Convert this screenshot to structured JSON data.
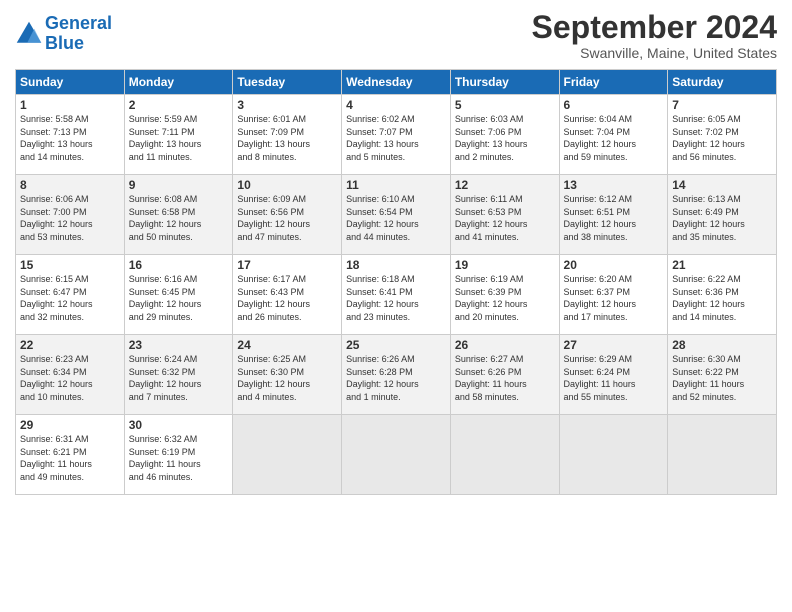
{
  "logo": {
    "line1": "General",
    "line2": "Blue"
  },
  "title": "September 2024",
  "subtitle": "Swanville, Maine, United States",
  "days_of_week": [
    "Sunday",
    "Monday",
    "Tuesday",
    "Wednesday",
    "Thursday",
    "Friday",
    "Saturday"
  ],
  "weeks": [
    [
      {
        "day": "1",
        "info": "Sunrise: 5:58 AM\nSunset: 7:13 PM\nDaylight: 13 hours\nand 14 minutes."
      },
      {
        "day": "2",
        "info": "Sunrise: 5:59 AM\nSunset: 7:11 PM\nDaylight: 13 hours\nand 11 minutes."
      },
      {
        "day": "3",
        "info": "Sunrise: 6:01 AM\nSunset: 7:09 PM\nDaylight: 13 hours\nand 8 minutes."
      },
      {
        "day": "4",
        "info": "Sunrise: 6:02 AM\nSunset: 7:07 PM\nDaylight: 13 hours\nand 5 minutes."
      },
      {
        "day": "5",
        "info": "Sunrise: 6:03 AM\nSunset: 7:06 PM\nDaylight: 13 hours\nand 2 minutes."
      },
      {
        "day": "6",
        "info": "Sunrise: 6:04 AM\nSunset: 7:04 PM\nDaylight: 12 hours\nand 59 minutes."
      },
      {
        "day": "7",
        "info": "Sunrise: 6:05 AM\nSunset: 7:02 PM\nDaylight: 12 hours\nand 56 minutes."
      }
    ],
    [
      {
        "day": "8",
        "info": "Sunrise: 6:06 AM\nSunset: 7:00 PM\nDaylight: 12 hours\nand 53 minutes."
      },
      {
        "day": "9",
        "info": "Sunrise: 6:08 AM\nSunset: 6:58 PM\nDaylight: 12 hours\nand 50 minutes."
      },
      {
        "day": "10",
        "info": "Sunrise: 6:09 AM\nSunset: 6:56 PM\nDaylight: 12 hours\nand 47 minutes."
      },
      {
        "day": "11",
        "info": "Sunrise: 6:10 AM\nSunset: 6:54 PM\nDaylight: 12 hours\nand 44 minutes."
      },
      {
        "day": "12",
        "info": "Sunrise: 6:11 AM\nSunset: 6:53 PM\nDaylight: 12 hours\nand 41 minutes."
      },
      {
        "day": "13",
        "info": "Sunrise: 6:12 AM\nSunset: 6:51 PM\nDaylight: 12 hours\nand 38 minutes."
      },
      {
        "day": "14",
        "info": "Sunrise: 6:13 AM\nSunset: 6:49 PM\nDaylight: 12 hours\nand 35 minutes."
      }
    ],
    [
      {
        "day": "15",
        "info": "Sunrise: 6:15 AM\nSunset: 6:47 PM\nDaylight: 12 hours\nand 32 minutes."
      },
      {
        "day": "16",
        "info": "Sunrise: 6:16 AM\nSunset: 6:45 PM\nDaylight: 12 hours\nand 29 minutes."
      },
      {
        "day": "17",
        "info": "Sunrise: 6:17 AM\nSunset: 6:43 PM\nDaylight: 12 hours\nand 26 minutes."
      },
      {
        "day": "18",
        "info": "Sunrise: 6:18 AM\nSunset: 6:41 PM\nDaylight: 12 hours\nand 23 minutes."
      },
      {
        "day": "19",
        "info": "Sunrise: 6:19 AM\nSunset: 6:39 PM\nDaylight: 12 hours\nand 20 minutes."
      },
      {
        "day": "20",
        "info": "Sunrise: 6:20 AM\nSunset: 6:37 PM\nDaylight: 12 hours\nand 17 minutes."
      },
      {
        "day": "21",
        "info": "Sunrise: 6:22 AM\nSunset: 6:36 PM\nDaylight: 12 hours\nand 14 minutes."
      }
    ],
    [
      {
        "day": "22",
        "info": "Sunrise: 6:23 AM\nSunset: 6:34 PM\nDaylight: 12 hours\nand 10 minutes."
      },
      {
        "day": "23",
        "info": "Sunrise: 6:24 AM\nSunset: 6:32 PM\nDaylight: 12 hours\nand 7 minutes."
      },
      {
        "day": "24",
        "info": "Sunrise: 6:25 AM\nSunset: 6:30 PM\nDaylight: 12 hours\nand 4 minutes."
      },
      {
        "day": "25",
        "info": "Sunrise: 6:26 AM\nSunset: 6:28 PM\nDaylight: 12 hours\nand 1 minute."
      },
      {
        "day": "26",
        "info": "Sunrise: 6:27 AM\nSunset: 6:26 PM\nDaylight: 11 hours\nand 58 minutes."
      },
      {
        "day": "27",
        "info": "Sunrise: 6:29 AM\nSunset: 6:24 PM\nDaylight: 11 hours\nand 55 minutes."
      },
      {
        "day": "28",
        "info": "Sunrise: 6:30 AM\nSunset: 6:22 PM\nDaylight: 11 hours\nand 52 minutes."
      }
    ],
    [
      {
        "day": "29",
        "info": "Sunrise: 6:31 AM\nSunset: 6:21 PM\nDaylight: 11 hours\nand 49 minutes."
      },
      {
        "day": "30",
        "info": "Sunrise: 6:32 AM\nSunset: 6:19 PM\nDaylight: 11 hours\nand 46 minutes."
      },
      {
        "day": "",
        "info": ""
      },
      {
        "day": "",
        "info": ""
      },
      {
        "day": "",
        "info": ""
      },
      {
        "day": "",
        "info": ""
      },
      {
        "day": "",
        "info": ""
      }
    ]
  ]
}
